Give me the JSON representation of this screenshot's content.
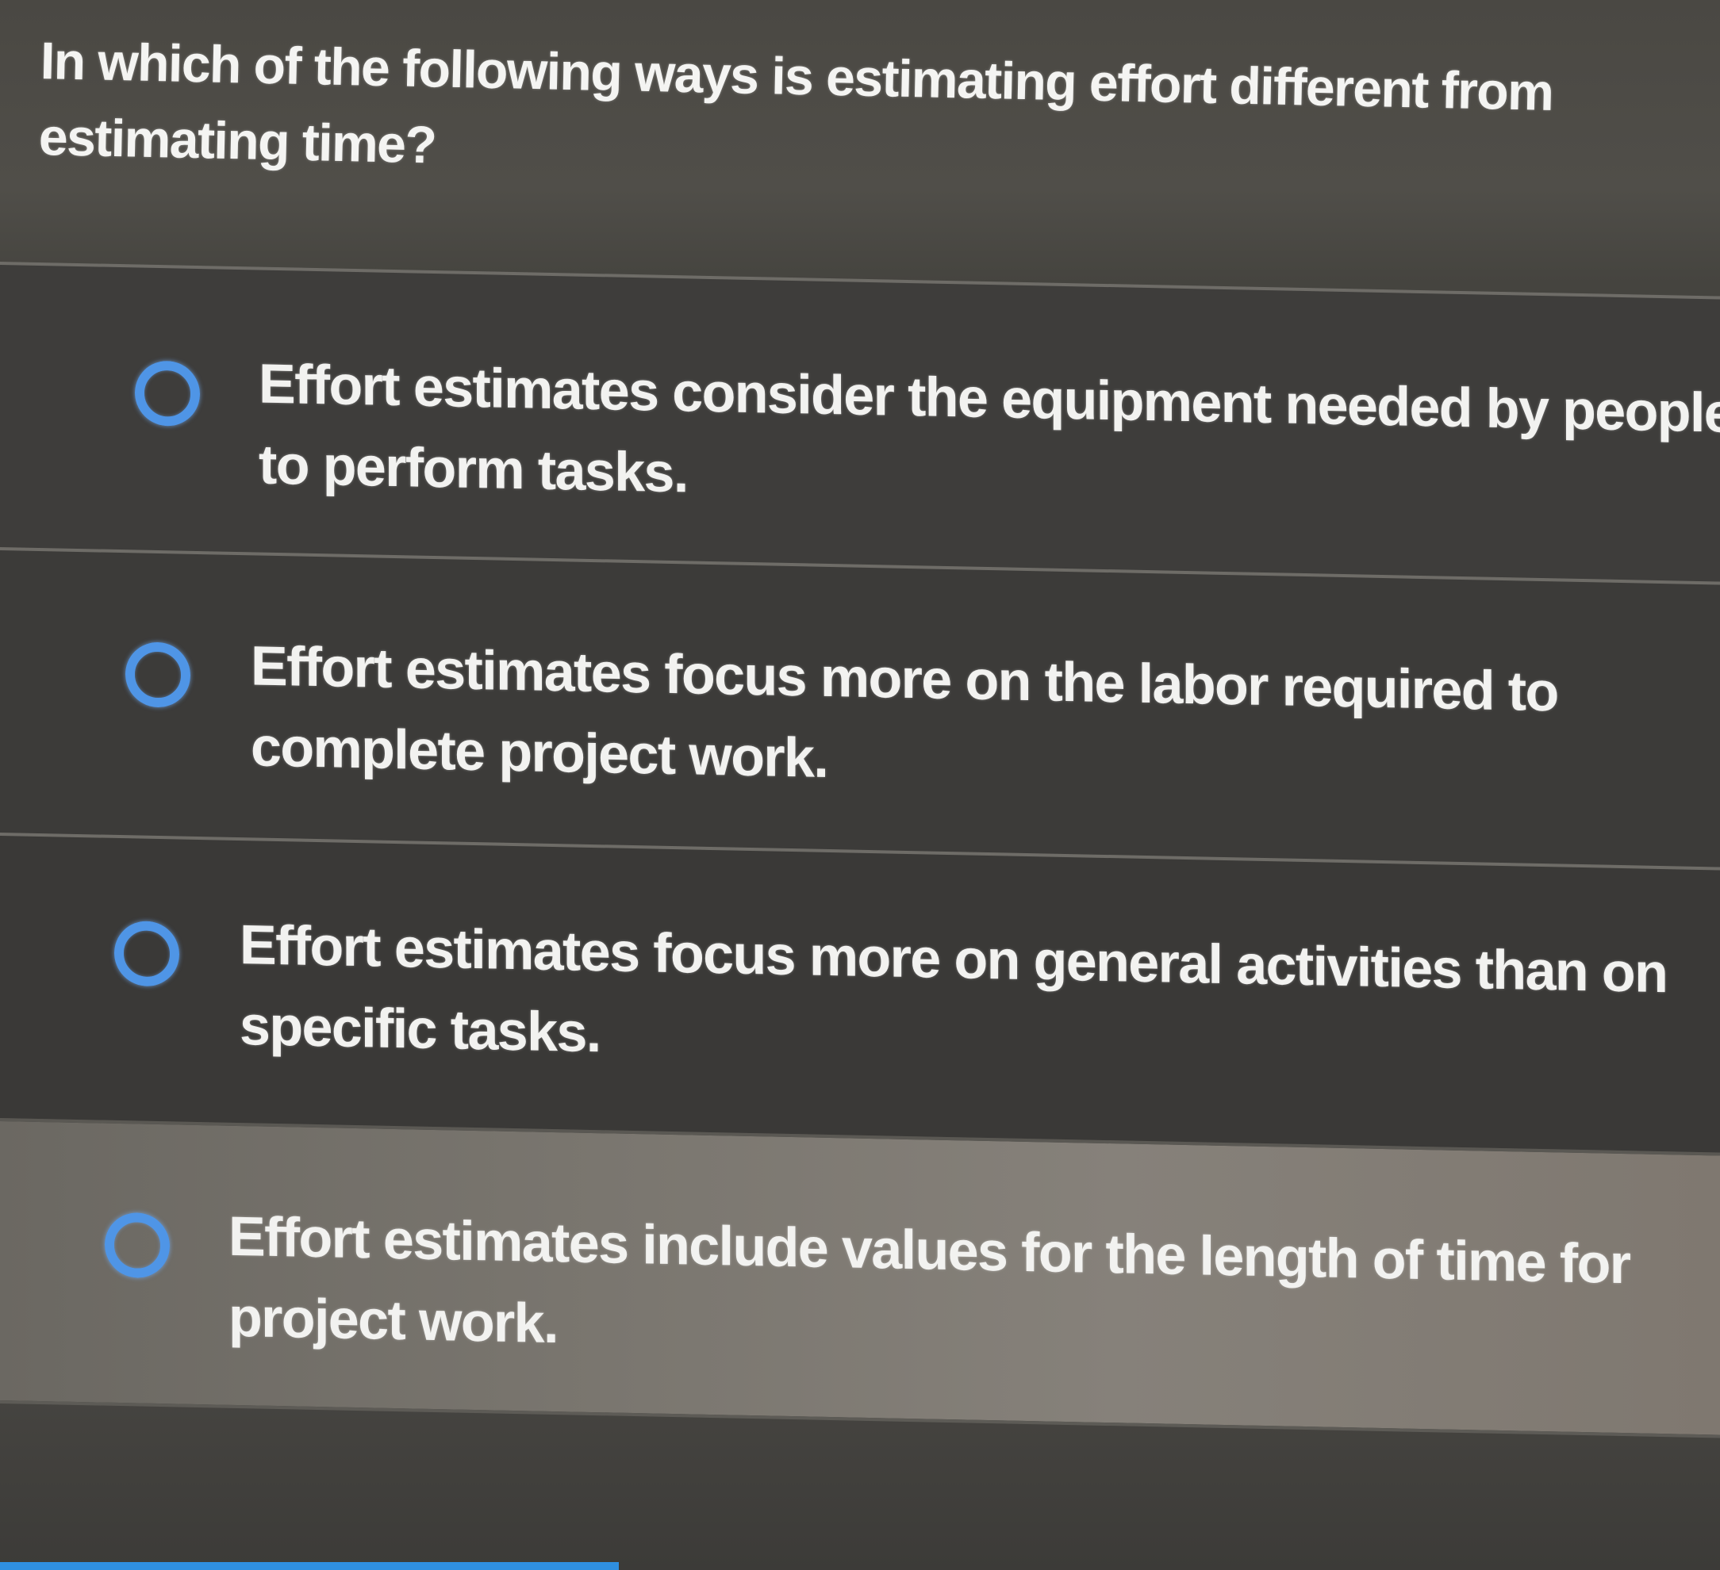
{
  "question": {
    "text": "In which of the following ways is estimating effort different from estimating time?"
  },
  "options": [
    {
      "label": "Effort estimates consider the equipment needed by people to perform tasks."
    },
    {
      "label": "Effort estimates focus more on the labor required to complete project work."
    },
    {
      "label": "Effort estimates focus more on general activities than on specific tasks."
    },
    {
      "label": "Effort estimates include values for the length of time for project work."
    }
  ],
  "colors": {
    "radio_accent": "#4f95e6",
    "text": "#f2f2f0",
    "background": "#3e3d3b",
    "progress_bar": "#2f8fe0"
  }
}
